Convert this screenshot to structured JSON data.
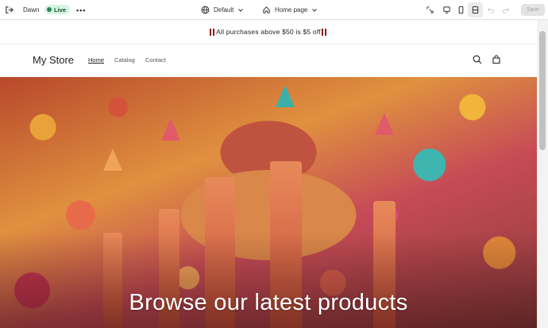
{
  "topbar": {
    "store_name": "Dawn",
    "status_badge": "Live",
    "more_label": "•••",
    "theme_select": "Default",
    "page_select": "Home page",
    "save_label": "Save"
  },
  "store": {
    "announcement": "All purchases above $50 is $5 off",
    "logo": "My Store",
    "nav": [
      "Home",
      "Catalog",
      "Contact"
    ],
    "hero_title": "Browse our latest products"
  },
  "colors": {
    "accent_live": "#29845a",
    "announcement_marks": "#8b1a1a"
  }
}
